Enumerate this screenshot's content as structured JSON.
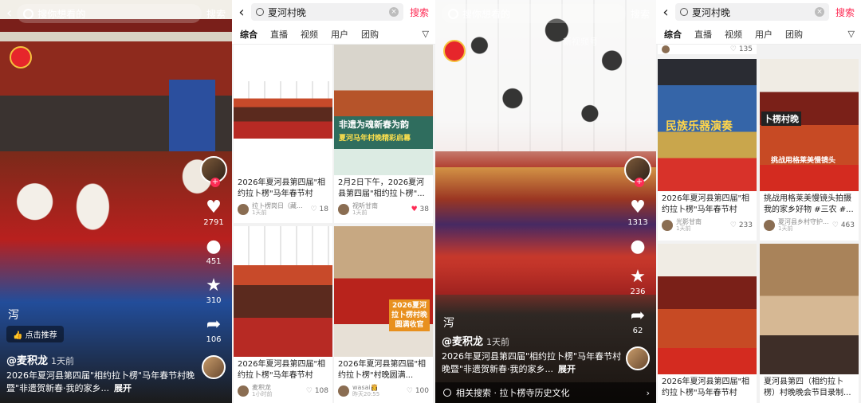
{
  "panel1": {
    "search_placeholder": "搜你想看的",
    "search_button": "搜索",
    "recommend_label": "点击推荐",
    "side_glyph": "泻",
    "likes": "2791",
    "comments": "451",
    "favorites": "310",
    "shares": "106",
    "author": "@麦积龙",
    "time": "1天前",
    "caption": "2026年夏河县第四届\"相约拉卜楞\"马年春节村晚暨\"非遗贺新春·我的家乡...",
    "expand_label": "展开"
  },
  "panel2": {
    "query": "夏河村晚",
    "search_button": "搜索",
    "tabs": [
      "综合",
      "直播",
      "视频",
      "用户",
      "团购"
    ],
    "filter_label": "▽",
    "cards_left": [
      {
        "title": "2026年夏河县第四届\"相约拉卜楞\"马年春节村晚...",
        "author": "拉卜楞岗日（藏...",
        "date": "1天前",
        "likes": "18"
      },
      {
        "title": "2026年夏河县第四届\"相约拉卜楞\"马年春节村晚...",
        "author": "麦积龙",
        "date": "1小时前",
        "likes": "108"
      }
    ],
    "cards_right": [
      {
        "thumb_text_1": "非遗为魂新春为韵",
        "thumb_text_2": "夏河马年村晚精彩启幕",
        "title": "2月2日下午，2026夏河县第四届\"相约拉卜楞\"...",
        "author": "视听甘南",
        "date": "1天前",
        "likes": "38"
      },
      {
        "thumb_text_1": "2026夏河",
        "thumb_text_2": "拉卜楞村晚",
        "thumb_text_3": "圆满收官",
        "title": "2026年夏河县第四届\"相约拉卜楞\"村晚圆满...",
        "author": "wasai👸",
        "date": "昨天20:55",
        "likes": "100"
      }
    ]
  },
  "panel3": {
    "search_placeholder": "搜你想看的",
    "search_button": "搜索",
    "watermark": "新视频号",
    "side_glyph": "泻",
    "likes": "1313",
    "comments": "",
    "favorites": "236",
    "shares": "62",
    "author": "@麦积龙",
    "time": "1天前",
    "caption": "2026年夏河县第四届\"相约拉卜楞\"马年春节村晚暨\"非遗贺新春·我的家乡...",
    "expand_label": "展开",
    "related_label": "相关搜索 · 拉卜楞寺历史文化"
  },
  "panel4": {
    "query": "夏河村晚",
    "search_button": "搜索",
    "tabs": [
      "综合",
      "直播",
      "视频",
      "用户",
      "团购"
    ],
    "filter_label": "▽",
    "top_left_likes": "135",
    "cards_left": [
      {
        "thumb_text": "民族乐器演奏",
        "title": "2026年夏河县第四届\"相约拉卜楞\"马年春节村晚...",
        "author": "光影甘南",
        "date": "1天前",
        "likes": "233"
      },
      {
        "title": "2026年夏河县第四届\"相约拉卜楞\"马年春节村晚...",
        "author": "",
        "date": "",
        "likes": ""
      }
    ],
    "cards_right": [
      {
        "thumb_text_1": "卜楞村晚",
        "thumb_text_2": "挑战用格莱美慢镜头",
        "title": "挑战用格莱美慢镜头拍摄我的家乡好物 #三农 #...",
        "author": "夏河县乡村守护...",
        "date": "1天前",
        "likes": "463"
      },
      {
        "title": "夏河县第四（相约拉卜楞）村晚晚会节目录制...",
        "author": "",
        "date": "",
        "likes": ""
      }
    ]
  },
  "colors": {
    "accent": "#fe2c55",
    "badge": "#e6262b"
  }
}
